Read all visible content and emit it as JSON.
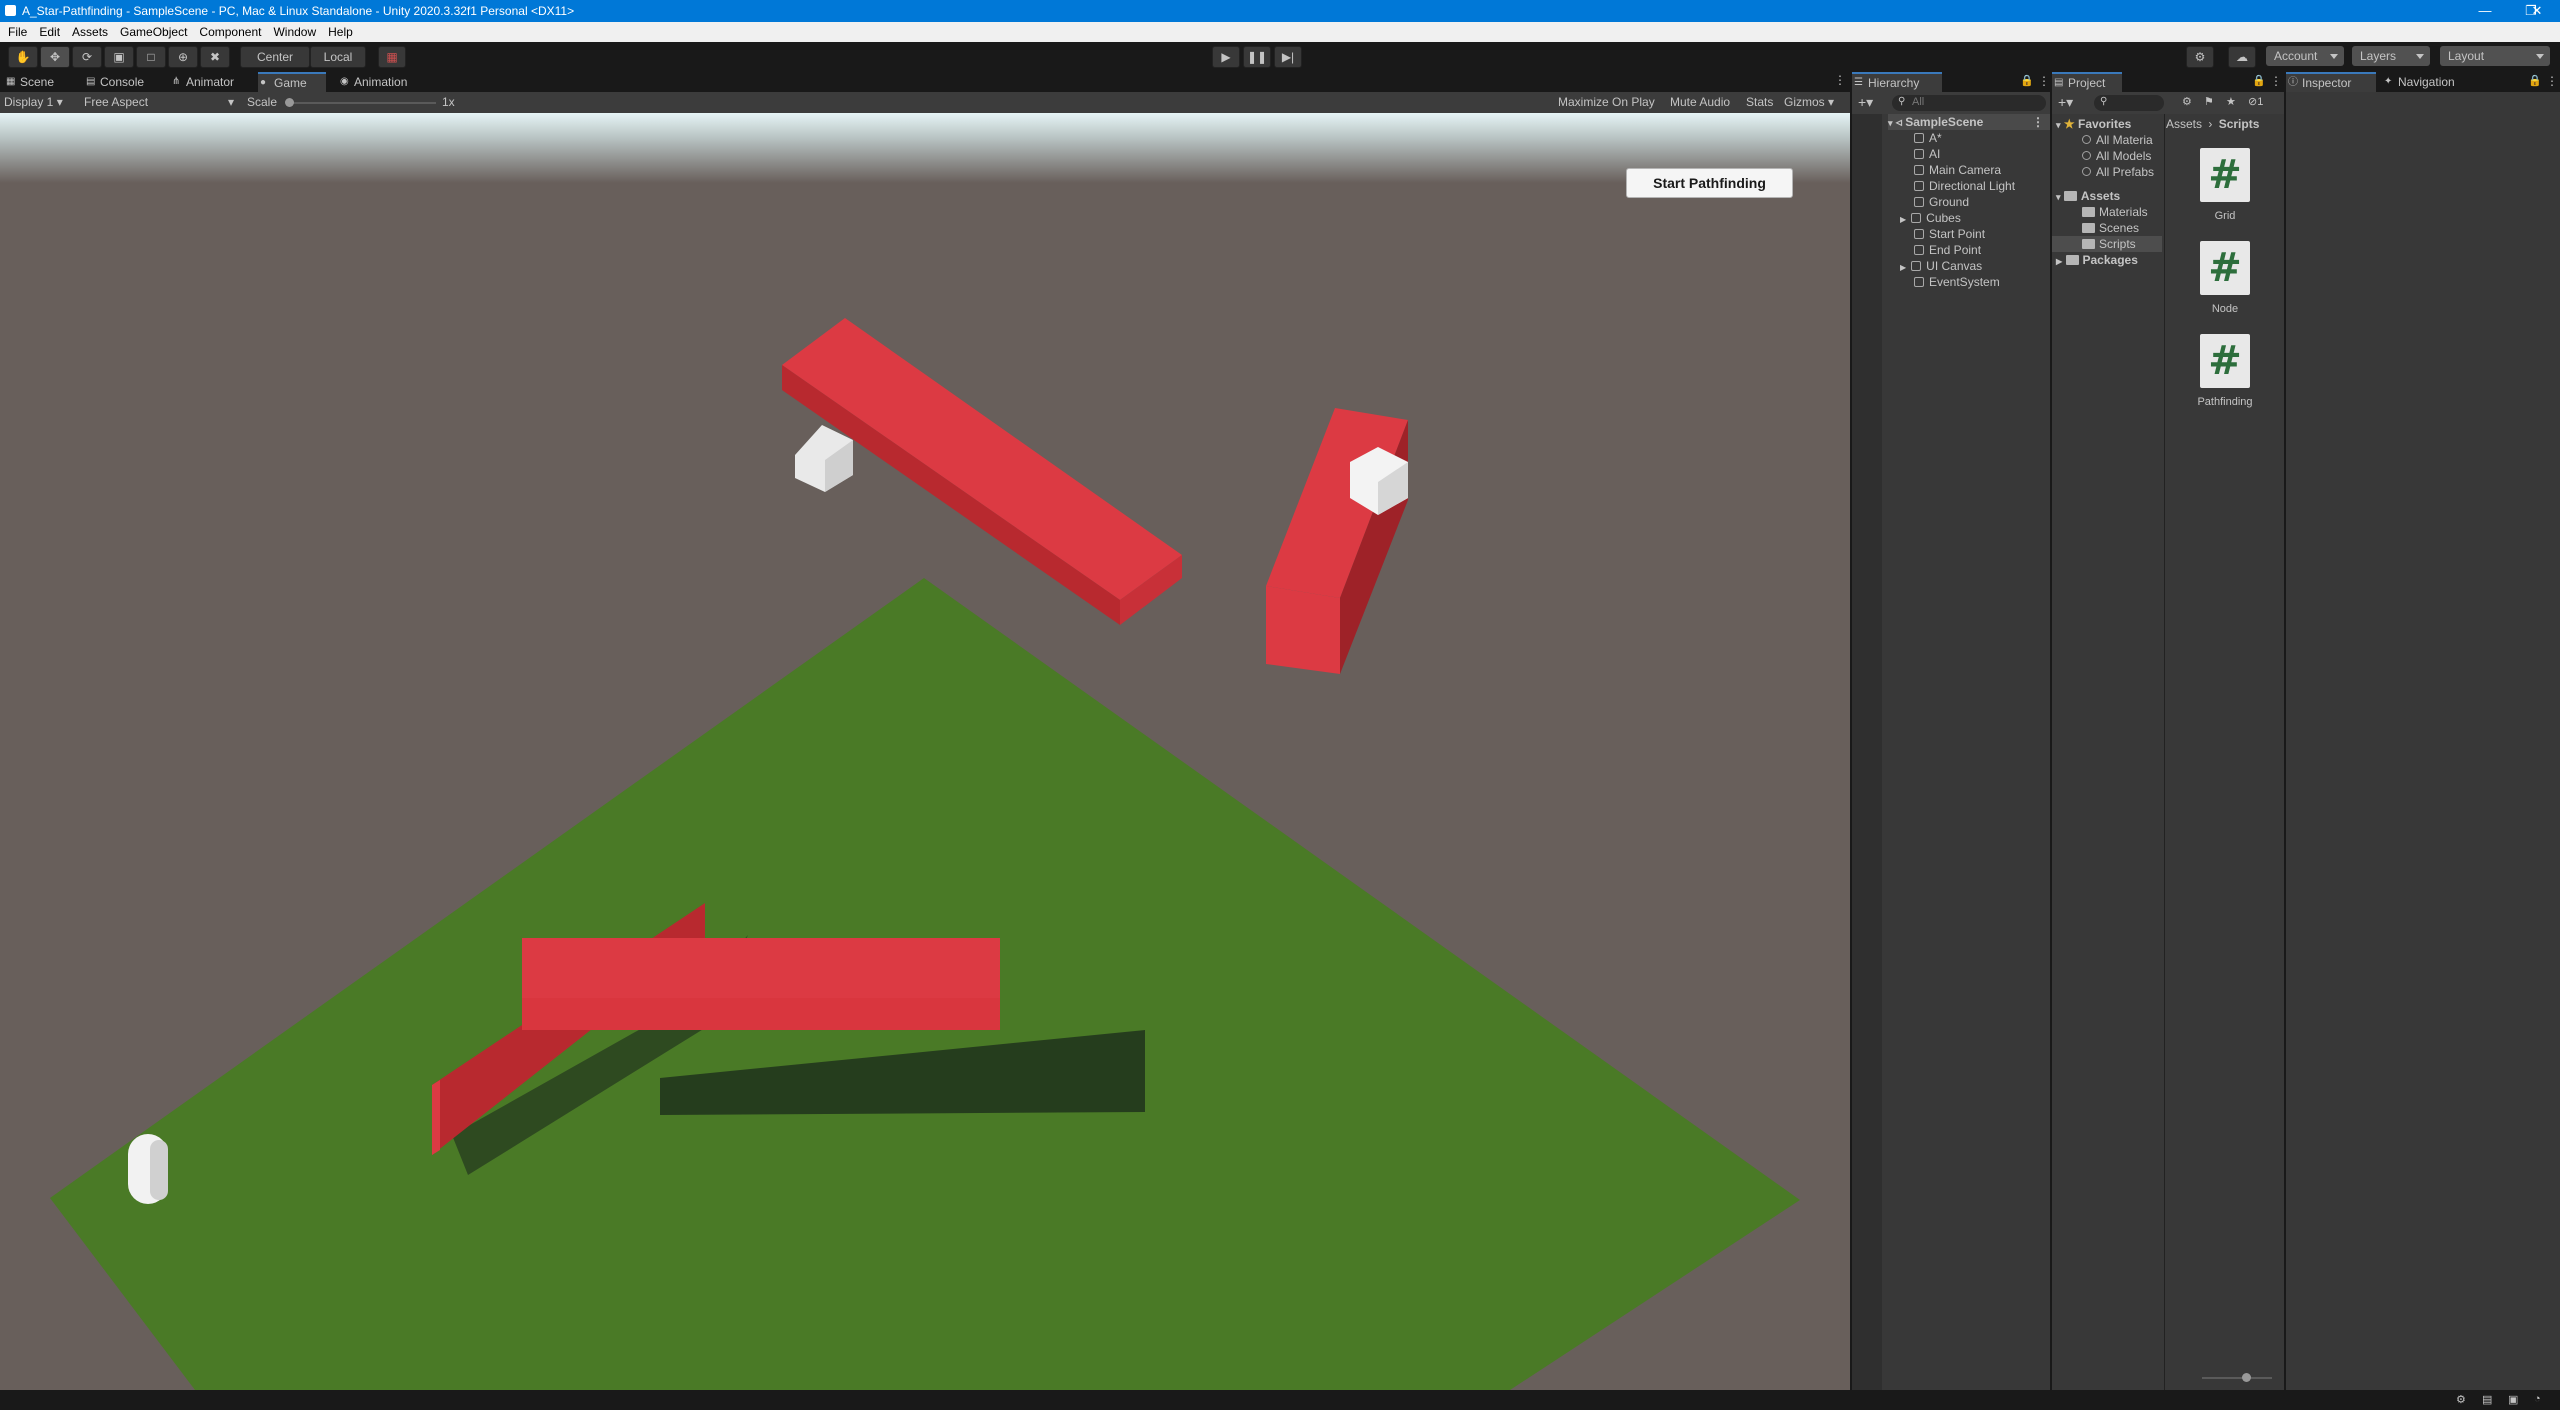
{
  "window": {
    "title": "A_Star-Pathfinding - SampleScene - PC, Mac & Linux Standalone - Unity 2020.3.32f1 Personal <DX11>"
  },
  "menu": [
    "File",
    "Edit",
    "Assets",
    "GameObject",
    "Component",
    "Window",
    "Help"
  ],
  "toolbar": {
    "pivot_center": "Center",
    "pivot_local": "Local",
    "account": "Account",
    "layers": "Layers",
    "layout": "Layout"
  },
  "tabs": {
    "scene": "Scene",
    "console": "Console",
    "animator": "Animator",
    "game": "Game",
    "animation": "Animation",
    "hierarchy": "Hierarchy",
    "project": "Project",
    "inspector": "Inspector",
    "navigation": "Navigation"
  },
  "gamebar": {
    "display": "Display 1",
    "aspect": "Free Aspect",
    "scale_label": "Scale",
    "scale_value": "1x",
    "maximize": "Maximize On Play",
    "mute": "Mute Audio",
    "stats": "Stats",
    "gizmos": "Gizmos"
  },
  "game_ui": {
    "start_button": "Start Pathfinding"
  },
  "hierarchy": {
    "search_placeholder": "All",
    "scene": "SampleScene",
    "items": [
      "A*",
      "AI",
      "Main Camera",
      "Directional Light",
      "Ground",
      "Cubes",
      "Start Point",
      "End Point",
      "UI Canvas",
      "EventSystem"
    ]
  },
  "project": {
    "favorites_label": "Favorites",
    "favorites": [
      "All Materia",
      "All Models",
      "All Prefabs"
    ],
    "assets_label": "Assets",
    "assets_children": [
      "Materials",
      "Scenes",
      "Scripts"
    ],
    "packages_label": "Packages",
    "breadcrumb_root": "Assets",
    "breadcrumb_current": "Scripts",
    "hidden_count": "1",
    "files": [
      "Grid",
      "Node",
      "Pathfinding"
    ]
  },
  "colors": {
    "accent": "#3a79bb",
    "ground": "#4a7a26",
    "wall": "#db3b44",
    "background": "#685f5b"
  }
}
